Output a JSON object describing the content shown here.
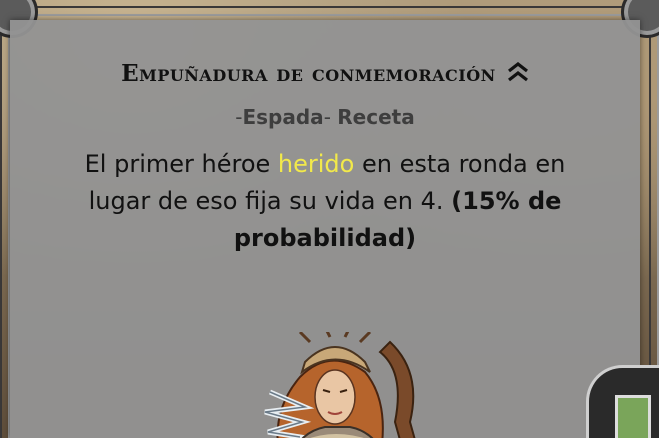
{
  "tooltip": {
    "title": "Empuñadura de conmemoración",
    "rank_icon": "double-chevron-up-icon",
    "subtitle_prefix": "-",
    "subtitle_type": "Espada",
    "subtitle_sep": "- ",
    "subtitle_category": "Receta",
    "description": {
      "part1": "El primer héroe ",
      "highlight": "herido",
      "part2": " en esta ronda en lugar de eso fija su vida en 4. ",
      "bold": "(15% de probabilidad)"
    },
    "highlight_color": "#f2e94a"
  }
}
